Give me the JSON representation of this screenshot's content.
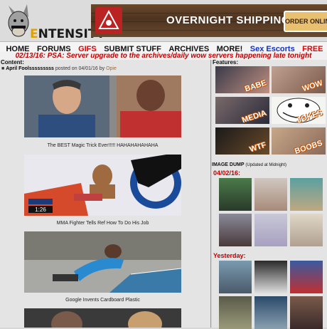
{
  "site": {
    "logo_prefix": "E",
    "logo_rest": "NTENSITY"
  },
  "banner": {
    "headline": "OVERNIGHT SHIPPING..",
    "button": "ORDER ONLINE"
  },
  "nav": {
    "items": [
      "HOME",
      "FORUMS",
      "GIFS",
      "SUBMIT STUFF",
      "ARCHIVES",
      "MORE!",
      "Sex Escorts",
      "FREE CAMS"
    ]
  },
  "psa": "02/13/16: PSA: Server upgrade to the archives/daily wow servers happening late tonight",
  "content": {
    "heading": "Content:",
    "post": {
      "title": "April Foolsssssssss",
      "posted_on": "posted on 04/01/16 by",
      "author": "Opie"
    },
    "videos": [
      {
        "caption": "The BEST Magic Trick Ever!!!!! HAHAHAHAHAHA"
      },
      {
        "caption": "MMA Fighter Tells Ref How To Do His Job",
        "timestamp": "1:26"
      },
      {
        "caption": "Google Invents Cardboard Plastic"
      }
    ]
  },
  "features": {
    "heading": "Features:",
    "tiles": [
      "BABE",
      "WOW",
      "MEDIA",
      "JOKES",
      "WTF",
      "BOOBS"
    ]
  },
  "image_dump": {
    "heading": "IMAGE DUMP",
    "note": "(Updated at Midnight)",
    "date_today": "04/02/16:",
    "date_yesterday": "Yesterday:"
  },
  "colors": {
    "accent_red": "#e00000",
    "link_blue": "#1030d0",
    "psa_red": "#c00000",
    "logo_gold": "#e0a000"
  }
}
